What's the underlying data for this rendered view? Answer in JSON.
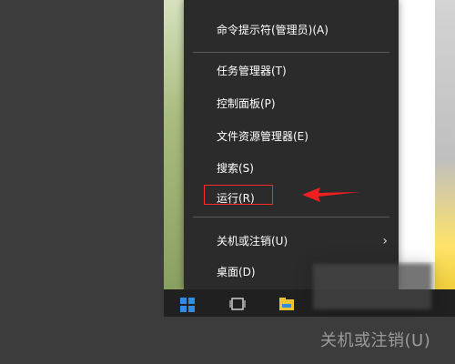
{
  "menu": {
    "items": [
      {
        "label": "命令提示符(管理员)(A)"
      },
      {
        "label": "任务管理器(T)"
      },
      {
        "label": "控制面板(P)"
      },
      {
        "label": "文件资源管理器(E)"
      },
      {
        "label": "搜索(S)"
      },
      {
        "label": "运行(R)"
      },
      {
        "label": "关机或注销(U)",
        "submenu": true
      },
      {
        "label": "桌面(D)"
      }
    ],
    "highlighted_index": 5
  },
  "background_text": "关机或注销(U)",
  "icons": {
    "start": "windows-logo-icon",
    "task_view": "task-view-icon",
    "file_explorer": "file-explorer-icon",
    "submenu": "chevron-right-icon",
    "callout": "red-arrow-icon"
  },
  "colors": {
    "menu_bg": "#2b2b2b",
    "menu_text": "#ffffff",
    "highlight": "#ff2a2a",
    "windows_blue": "#2f8be6"
  }
}
